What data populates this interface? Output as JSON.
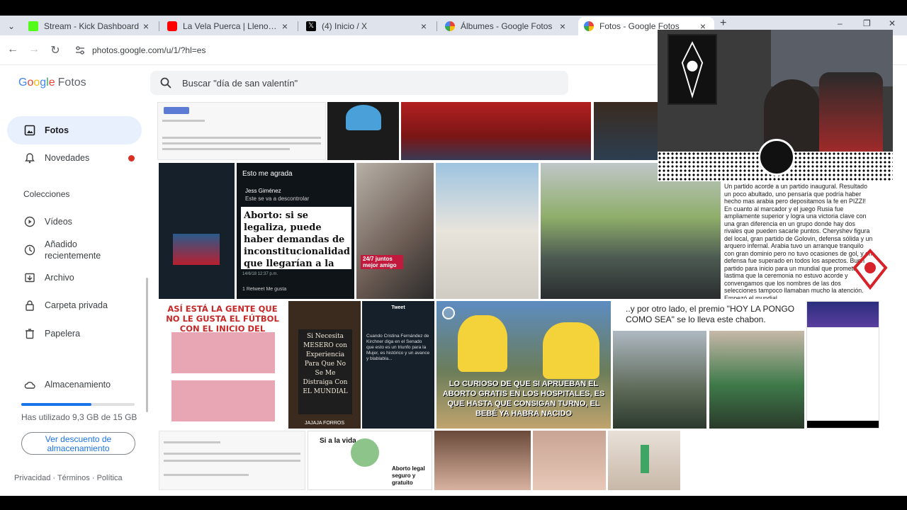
{
  "browser": {
    "tabs": [
      {
        "title": "Stream - Kick Dashboard",
        "color": "#53fc18"
      },
      {
        "title": "La Vela Puerca | Llenos de Magia",
        "color": "#ff0000"
      },
      {
        "title": "(4) Inicio / X",
        "color": "#000000"
      },
      {
        "title": "Álbumes - Google Fotos",
        "color": "#4285f4"
      },
      {
        "title": "Fotos - Google Fotos",
        "color": "#4285f4"
      }
    ],
    "url": "photos.google.com/u/1/?hl=es"
  },
  "app": {
    "brand_google": [
      "G",
      "o",
      "o",
      "g",
      "l",
      "e"
    ],
    "brand_fotos": "Fotos",
    "search_placeholder": "Buscar \"día de san valentín\""
  },
  "sidebar": {
    "primary": [
      {
        "label": "Fotos",
        "icon": "photo-icon"
      },
      {
        "label": "Novedades",
        "icon": "bell-icon"
      }
    ],
    "section_title": "Colecciones",
    "collections": [
      {
        "label": "Vídeos",
        "icon": "play-circle-icon"
      },
      {
        "label": "Añadido recientemente",
        "icon": "clock-icon"
      },
      {
        "label": "Archivo",
        "icon": "archive-icon"
      },
      {
        "label": "Carpeta privada",
        "icon": "lock-icon"
      },
      {
        "label": "Papelera",
        "icon": "trash-icon"
      }
    ],
    "storage": {
      "label": "Almacenamiento",
      "usage_text": "Has utilizado 9,3 GB de 15 GB",
      "fraction_used": 0.62,
      "button_label": "Ver descuento de almacenamiento"
    },
    "footer": [
      "Privacidad",
      "Términos",
      "Política"
    ]
  },
  "photos": {
    "row2_tweet_header": "Esto me agrada",
    "row2_tweet_user": "Jess Giménez",
    "row2_tweet_reply": "Este se va a descontrolar",
    "row2_tweet_body": "Aborto: si se legaliza, puede haber demandas de inconstitucionalidad que llegarían a la",
    "row2_tweet_footer": "1 Retweet  Me gusta",
    "row2_tweet_time": "14/6/18 12:37 p.m.",
    "row2_selfie_tag": "24/7 juntos mejor amigo",
    "row2_article": "Un partido acorde a un partido inaugural. Resultado un poco abultado, uno pensaría que podría haber hecho mas arabia pero depositamos la fe en PIZZI! En cuanto al marcador y el juego Rusia fue ampliamente superior y logra una victoria clave con una gran diferencia en un grupo donde hay dos rivales que pueden sacarle puntos. Cheryshev figura del local, gran partido de Golovin, defensa sólida y un arquero infernal. Arabia tuvo un arranque tranquilo con gran dominio pero no tuvo ocasiones de gol, y en defensa fue superado en todos los aspectos. Buen partido para inicio para un mundial que promete, lastima que la ceremonia no estuvo acorde y convengamos que los nombres de las dos selecciones tampoco llamaban mucho la atención. Empezó el mundial.",
    "row3_meme_caption": "ASÍ ESTÁ LA GENTE QUE NO LE GUSTA EL FÚTBOL CON EL INICIO DEL MUNDIAL.",
    "row3_chalk_sign": "Si Necesita MESERO con Experiencia Para Que No Se Me Distraiga Con EL MUNDIAL",
    "row3_chalk_credit": "JAJAJA FORROS",
    "row3_tweet_title": "Tweet",
    "row3_tweet_body": "Cuando Cristina Fernández de Kirchner diga en el Senado que esto es un triunfo para la Mujer, es histórico y un avance y blablabla...",
    "row3_simpsons_caption": "LO CURIOSO DE QUE SI APRUEBAN EL ABORTO GRATIS EN LOS HOSPITALES, ES QUE HASTA QUE CONSIGAN TURNO, EL BEBÉ YA HABRA NACIDO",
    "row3_premio_text": "..y por otro lado, el premio \"HOY LA PONGO COMO SEA\" se lo lleva este chabon.",
    "row4_comic_bubble": "Si a la vida",
    "row4_comic_sign": "Aborto legal seguro y gratuito"
  },
  "overlay": {
    "webcam_logo": "spider-logo-icon"
  }
}
